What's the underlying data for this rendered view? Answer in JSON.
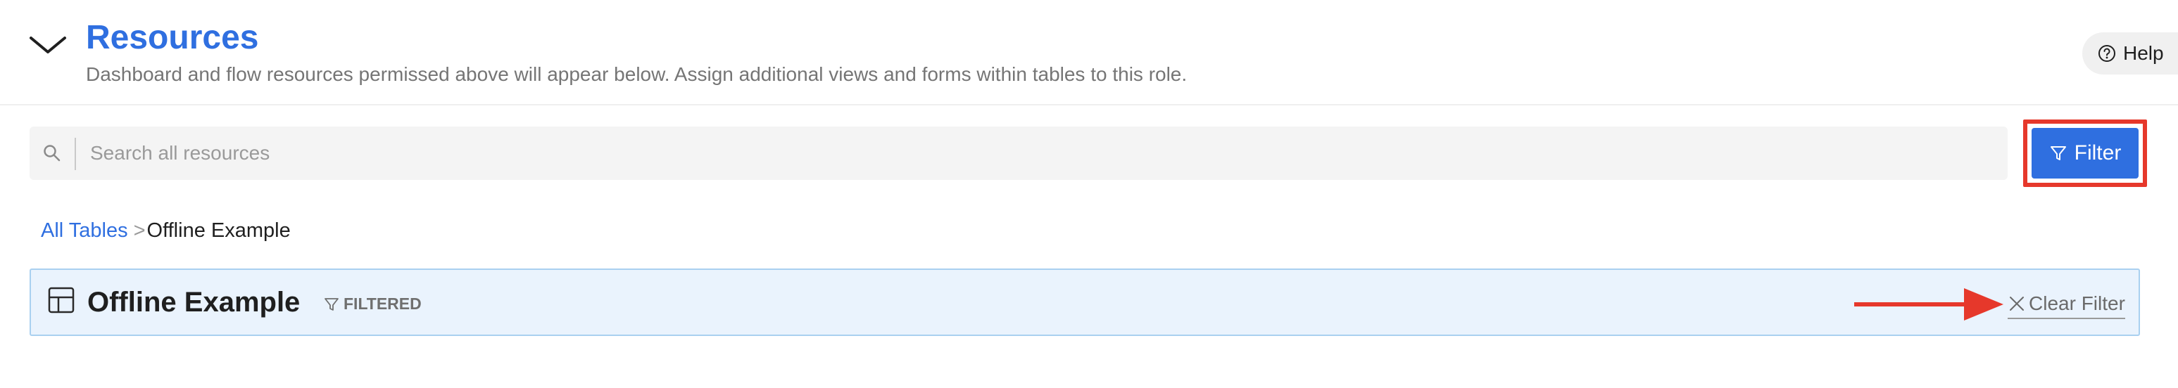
{
  "header": {
    "title": "Resources",
    "subtitle": "Dashboard and flow resources permissed above will appear below. Assign additional views and forms within tables to this role.",
    "help_label": "Help"
  },
  "search": {
    "placeholder": "Search all resources",
    "value": ""
  },
  "filter_button": {
    "label": "Filter"
  },
  "breadcrumb": {
    "root": "All Tables",
    "separator": ">",
    "current": "Offline Example"
  },
  "table_panel": {
    "title": "Offline Example",
    "badge": "FILTERED",
    "clear_label": "Clear Filter"
  },
  "colors": {
    "accent": "#2f6fe0",
    "annotation": "#e6382b",
    "panel_bg": "#eaf3fd",
    "panel_border": "#a9d0f0"
  },
  "icons": [
    "chevron-down-icon",
    "help-circle-icon",
    "search-icon",
    "filter-funnel-icon",
    "table-grid-icon",
    "close-x-icon"
  ]
}
